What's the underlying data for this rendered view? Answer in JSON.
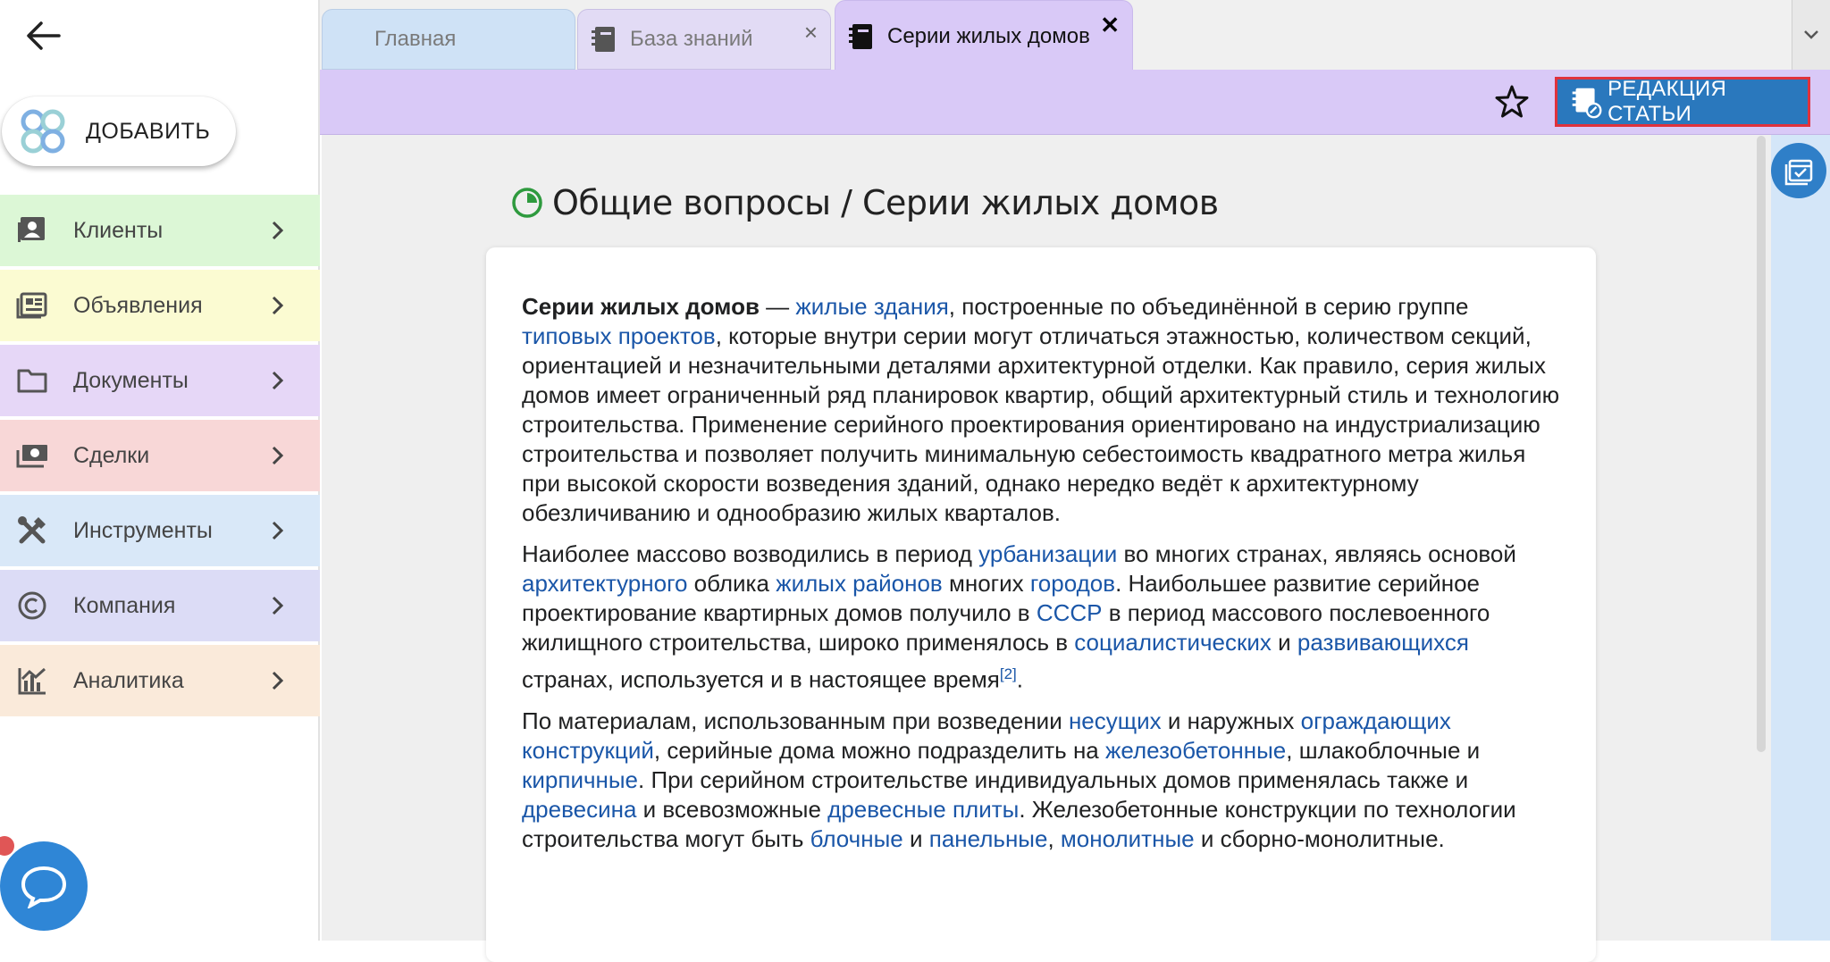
{
  "sidebar": {
    "add_label": "ДОБАВИТЬ",
    "items": [
      {
        "label": "Клиенты",
        "icon": "contacts-icon",
        "bg": "#dcf7d6"
      },
      {
        "label": "Объявления",
        "icon": "listing-icon",
        "bg": "#fbfbd2"
      },
      {
        "label": "Документы",
        "icon": "folder-icon",
        "bg": "#e6d7f7"
      },
      {
        "label": "Сделки",
        "icon": "money-icon",
        "bg": "#f8d7d7"
      },
      {
        "label": "Инструменты",
        "icon": "tools-icon",
        "bg": "#d9e8f8"
      },
      {
        "label": "Компания",
        "icon": "copyright-icon",
        "bg": "#dcdcf6"
      },
      {
        "label": "Аналитика",
        "icon": "analytics-icon",
        "bg": "#faeada"
      }
    ]
  },
  "tabs": [
    {
      "label": "Главная"
    },
    {
      "label": "База знаний",
      "close": "×"
    },
    {
      "label": "Серии жилых домов",
      "close": "✕",
      "active": true
    }
  ],
  "toolbar": {
    "edit_label": "РЕДАКЦИЯ СТАТЬИ"
  },
  "page": {
    "title": "Общие вопросы / Серии жилых домов"
  },
  "article": {
    "p1": {
      "bold": "Серии жилых домов",
      "t1": " — ",
      "l1": "жилые здания",
      "t2": ", построенные по объединённой в серию группе ",
      "l2": "типовых проектов",
      "t3": ", которые внутри серии могут отличаться этажностью, количеством секций, ориентацией и незначительными деталями архитектурной отделки. Как правило, серия жилых домов имеет ограниченный ряд планировок квартир, общий архитектурный стиль и технологию строительства. Применение серийного проектирования ориентировано на индустриализацию строительства и позволяет получить минимальную себестоимость квадратного метра жилья при высокой скорости возведения зданий, однако нередко ведёт к архитектурному обезличиванию и однообразию жилых кварталов."
    },
    "p2": {
      "t1": "Наиболее массово возводились в период ",
      "l1": "урбанизации",
      "t2": " во многих странах, являясь основой ",
      "l2": "архитектурного",
      "t3": " облика ",
      "l3": "жилых районов",
      "t4": " многих ",
      "l4": "городов",
      "t5": ". Наибольшее развитие серийное проектирование квартирных домов получило в ",
      "l5": "СССР",
      "t6": " в период массового послевоенного жилищного строительства, широко применялось в ",
      "l6": "социалистических",
      "t7": " и ",
      "l7": "развивающихся",
      "t8": " странах, используется и в настоящее время",
      "ref": "[2]",
      "t9": "."
    },
    "p3": {
      "t1": "По материалам, использованным при возведении ",
      "l1": "несущих",
      "t2": " и наружных ",
      "l2": "ограждающих конструкций",
      "t3": ", серийные дома можно подразделить на ",
      "l3": "железобетонные",
      "t4": ", шлакоблочные и ",
      "l4": "кирпичные",
      "t5": ". При серийном строительстве индивидуальных домов применялась также и ",
      "l5": "древесина",
      "t6": " и всевозможные ",
      "l6": "древесные плиты",
      "t7": ". Железобетонные конструкции по технологии строительства могут быть ",
      "l7": "блочные",
      "t8": " и ",
      "l8": "панельные",
      "t9": ", ",
      "l9": "монолитные",
      "t10": " и сборно-монолитные."
    }
  },
  "colors": {
    "accent": "#2a78bd",
    "link": "#1a56a8",
    "tab_active": "#d9c9f7",
    "highlight_border": "#e0323c"
  }
}
